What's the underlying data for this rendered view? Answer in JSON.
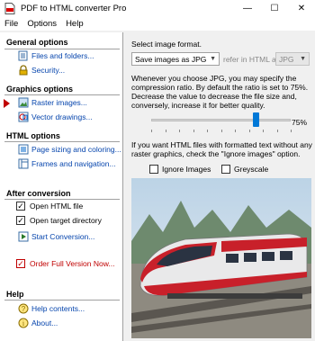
{
  "window": {
    "title": "PDF to HTML converter Pro",
    "controls": [
      "minimize-icon",
      "maximize-icon",
      "close-icon"
    ]
  },
  "menu": [
    "File",
    "Options",
    "Help"
  ],
  "sidebar": {
    "general": {
      "heading": "General options",
      "items": [
        "Files and folders...",
        "Security..."
      ]
    },
    "graphics": {
      "heading": "Graphics options",
      "items": [
        "Raster images...",
        "Vector drawings..."
      ]
    },
    "html": {
      "heading": "HTML options",
      "items": [
        "Page sizing and coloring...",
        "Frames and navigation..."
      ]
    },
    "after": {
      "heading": "After conversion",
      "open_html": "Open HTML file",
      "open_target": "Open target directory",
      "start": "Start Conversion...",
      "order": "Order Full Version Now..."
    },
    "help": {
      "heading": "Help",
      "items": [
        "Help contents...",
        "About..."
      ]
    }
  },
  "panel": {
    "select_label": "Select image format.",
    "format_value": "Save images as JPG",
    "refer_label": "refer in HTML as",
    "refer_value": "JPG",
    "description": "Whenever you choose JPG, you may specify the compression ratio. By default the ratio is set to 75%. Decrease the value to decrease the file size and, conversely, increase it for better quality.",
    "quality_value": "75%",
    "quality_fraction": 0.75,
    "ignore_note": "If you want HTML files with formatted text without any raster graphics, check the \"Ignore images\" option.",
    "ignore_images": "Ignore Images",
    "greyscale": "Greyscale",
    "preview_subject": "train-photo"
  },
  "colors": {
    "link": "#0645ad",
    "accent_red": "#c00000",
    "slider": "#0078d7"
  }
}
